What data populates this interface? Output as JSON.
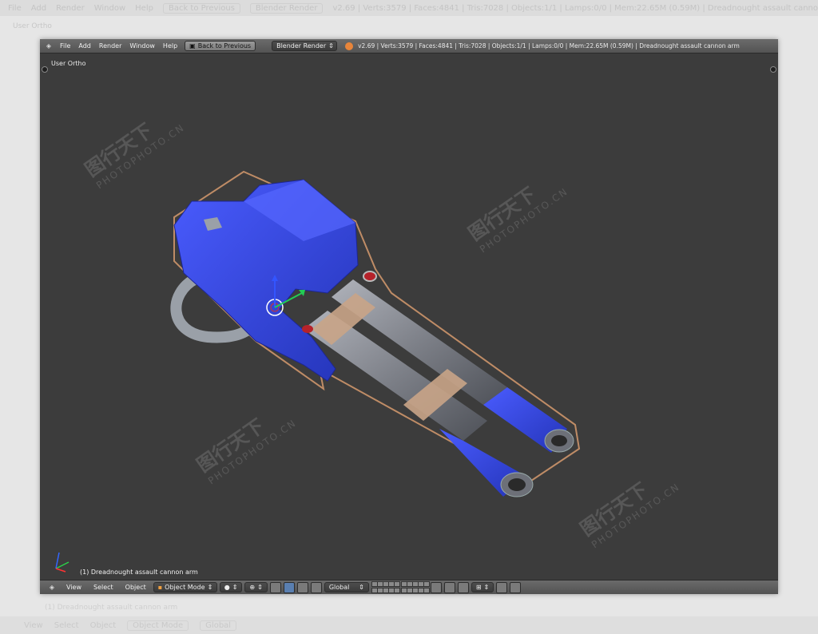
{
  "background": {
    "header_items": [
      "File",
      "Add",
      "Render",
      "Window",
      "Help"
    ],
    "back_label": "Back to Previous",
    "engine": "Blender Render",
    "stats": "v2.69 | Verts:3579 | Faces:4841 | Tris:7028 | Objects:1/1 | Lamps:0/0 | Mem:22.65M (0.59M) | Dreadnought assault cannon arm",
    "view_label": "User Ortho",
    "object_label": "(1) Dreadnought assault cannon arm",
    "footer_items": [
      "View",
      "Select",
      "Object"
    ],
    "mode": "Object Mode",
    "orientation": "Global"
  },
  "header": {
    "menus": [
      "File",
      "Add",
      "Render",
      "Window",
      "Help"
    ],
    "back_button": "Back to Previous",
    "render_engine": "Blender Render",
    "stats": "v2.69 | Verts:3579 | Faces:4841 | Tris:7028 | Objects:1/1 | Lamps:0/0 | Mem:22.65M (0.59M) | Dreadnought assault cannon arm"
  },
  "viewport": {
    "view_label": "User Ortho",
    "object_label": "(1) Dreadnought assault cannon arm"
  },
  "footer": {
    "menus": [
      "View",
      "Select",
      "Object"
    ],
    "mode": "Object Mode",
    "orientation": "Global"
  },
  "watermark": {
    "text": "图行天下",
    "sub": "PHOTOPHOTO.CN"
  },
  "colors": {
    "viewport_bg": "#3c3c3c",
    "model_blue": "#2f3fd0",
    "barrel_grey": "#8a8d95",
    "selection_outline": "#e0a070",
    "header_bg": "#5e5e5e"
  }
}
